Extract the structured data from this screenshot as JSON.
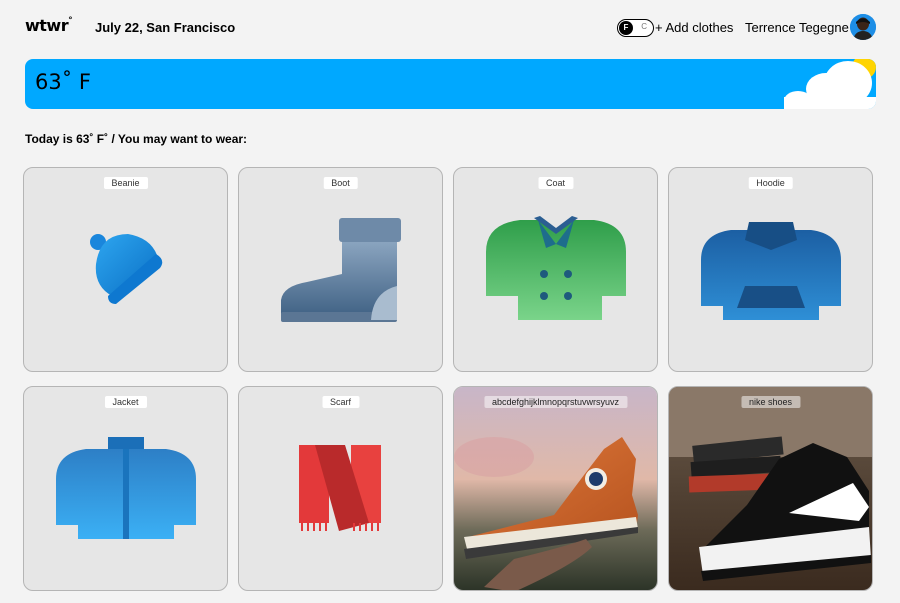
{
  "header": {
    "logo": "wtwr",
    "logo_mark": "°",
    "date_location": "July 22, San Francisco",
    "toggle": {
      "on_label": "F",
      "off_label": "C"
    },
    "add_clothes": "+ Add clothes",
    "username": "Terrence Tegegne"
  },
  "weather": {
    "temperature": "63˚ F"
  },
  "suggestion": "Today is 63˚ F˚ / You may want to wear:",
  "items": [
    {
      "label": "Beanie"
    },
    {
      "label": "Boot"
    },
    {
      "label": "Coat"
    },
    {
      "label": "Hoodie"
    },
    {
      "label": "Jacket"
    },
    {
      "label": "Scarf"
    },
    {
      "label": "abcdefghijklmnopqrstuvwrsyuvz"
    },
    {
      "label": "nike shoes"
    }
  ],
  "colors": {
    "banner": "#00a8ff",
    "card_bg": "#e6e6e6",
    "page_bg": "#f3f3f3"
  }
}
